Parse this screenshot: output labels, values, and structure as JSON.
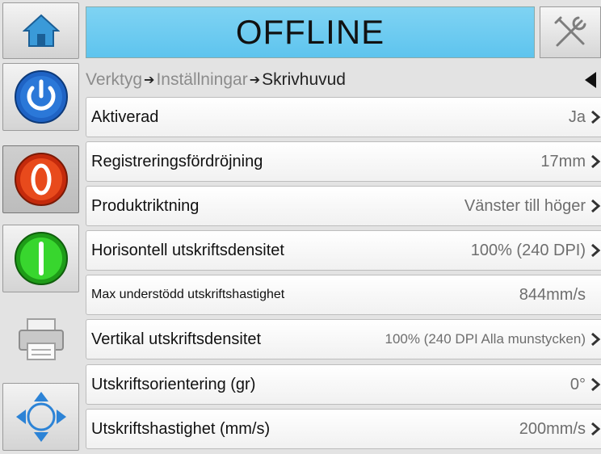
{
  "header": {
    "status": "OFFLINE"
  },
  "icons": {
    "home": "home-icon",
    "tools": "tools-icon",
    "power": "power-icon",
    "stop": "stop-icon",
    "start": "start-icon",
    "printer": "printer-icon",
    "navigate": "navigate-icon"
  },
  "colors": {
    "status_bg": "#6ccbf1",
    "power": "#1f63c4",
    "stop": "#e03a14",
    "start": "#2cc524"
  },
  "breadcrumb": {
    "items": [
      "Verktyg",
      "Inställningar",
      "Skrivhuvud"
    ]
  },
  "settings": [
    {
      "label": "Aktiverad",
      "value": "Ja"
    },
    {
      "label": "Registreringsfördröjning",
      "value": "17mm"
    },
    {
      "label": "Produktriktning",
      "value": "Vänster till höger"
    },
    {
      "label": "Horisontell utskriftsdensitet",
      "value": "100% (240 DPI)"
    },
    {
      "label": "Max understödd utskriftshastighet",
      "value": "844mm/s"
    },
    {
      "label": "Vertikal utskriftsdensitet",
      "value": "100% (240 DPI Alla munstycken)"
    },
    {
      "label": "Utskriftsorientering (gr)",
      "value": "0°"
    },
    {
      "label": "Utskriftshastighet (mm/s)",
      "value": "200mm/s"
    }
  ]
}
